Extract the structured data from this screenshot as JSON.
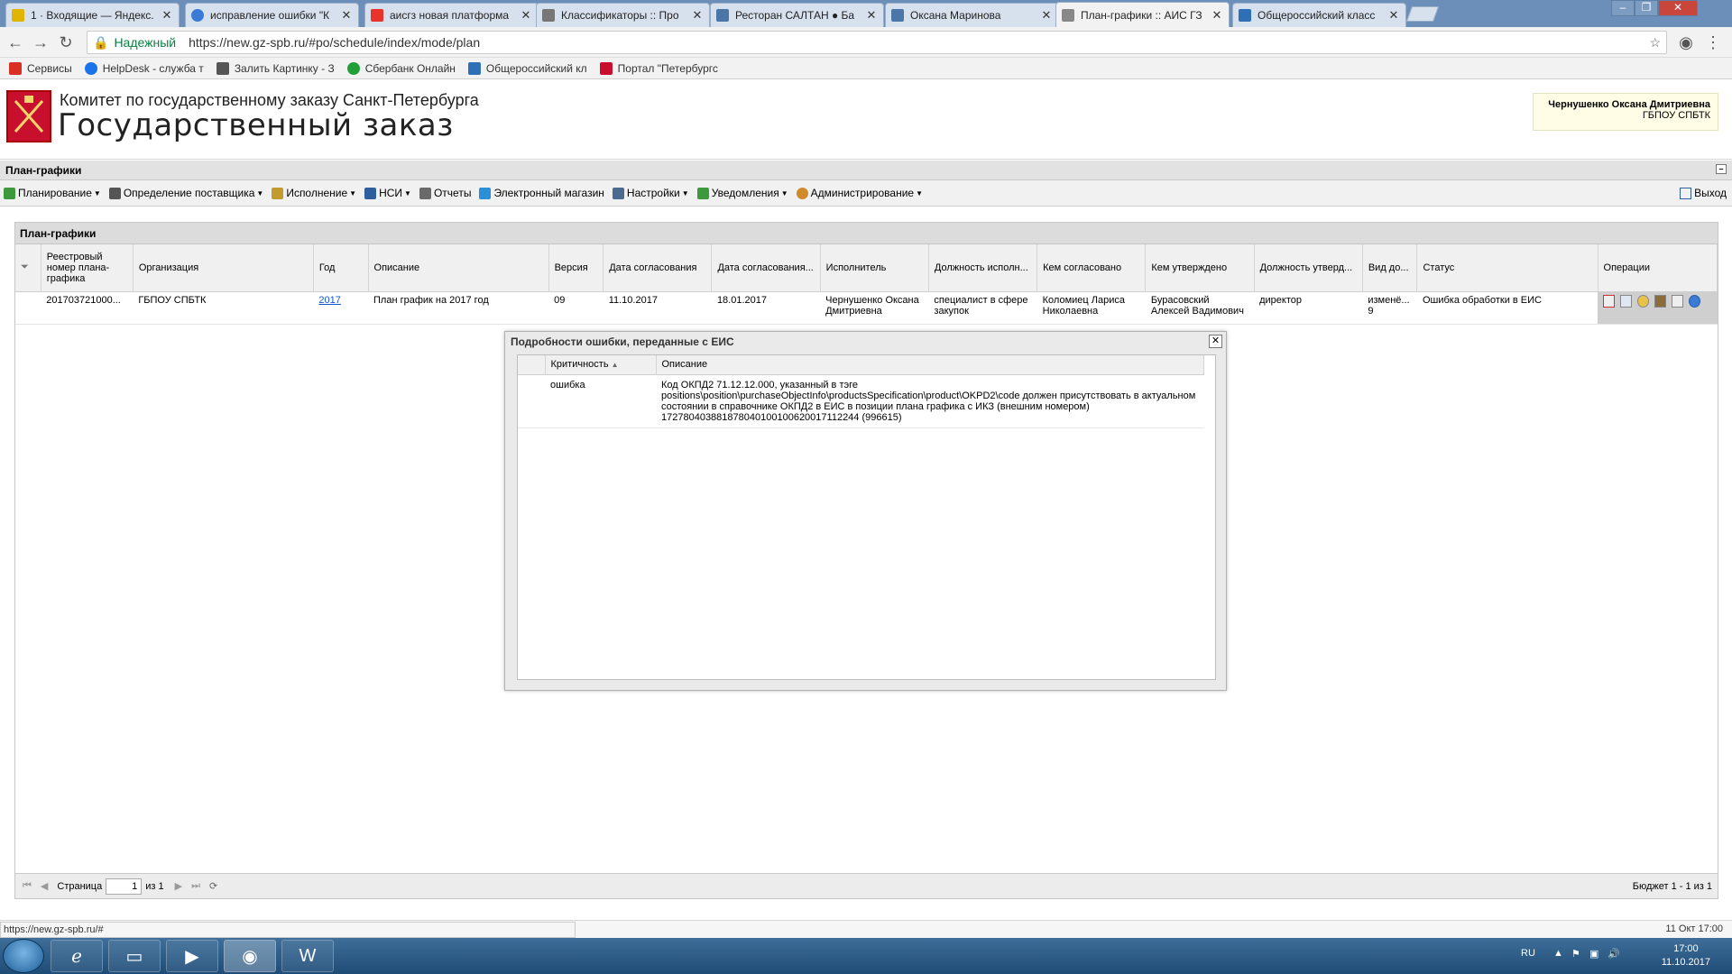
{
  "browser": {
    "tabs": [
      {
        "title": "1 · Входящие — Яндекс.",
        "favicon_color": "#e0b400"
      },
      {
        "title": "исправление ошибки \"К",
        "favicon_color": "#3a7bd5"
      },
      {
        "title": "аисгз новая платформа",
        "favicon_color": "#e8322b"
      },
      {
        "title": "Классификаторы :: Про",
        "favicon_color": "#777777"
      },
      {
        "title": "Ресторан САЛТАН ● Ба",
        "favicon_color": "#4a76a8"
      },
      {
        "title": "Оксана Маринова",
        "favicon_color": "#4a76a8"
      },
      {
        "title": "План-графики :: АИС ГЗ",
        "favicon_color": "#888888"
      },
      {
        "title": "Общероссийский класс",
        "favicon_color": "#2f6fb5"
      }
    ],
    "secure_label": "Надежный",
    "url": "https://new.gz-spb.ru/#po/schedule/index/mode/plan",
    "bookmarks": [
      {
        "label": "Сервисы",
        "color": "#d93025"
      },
      {
        "label": "HelpDesk - служба т",
        "color": "#1a73e8"
      },
      {
        "label": "Залить Картинку - З",
        "color": "#555555"
      },
      {
        "label": "Сбербанк Онлайн",
        "color": "#21a038"
      },
      {
        "label": "Общероссийский кл",
        "color": "#2f6fb5"
      },
      {
        "label": "Портал \"Петербургс",
        "color": "#c8102e"
      }
    ]
  },
  "header": {
    "org_line": "Комитет по государственному заказу Санкт-Петербурга",
    "title": "Государственный заказ",
    "user_name": "Чернушенко Оксана Дмитриевна",
    "user_org": "ГБПОУ СПБТК"
  },
  "section_title": "План-графики",
  "menu": [
    {
      "label": "Планирование",
      "dropdown": true,
      "color": "#3c9a3c"
    },
    {
      "label": "Определение поставщика",
      "dropdown": true,
      "color": "#555555"
    },
    {
      "label": "Исполнение",
      "dropdown": true,
      "color": "#c29a2e"
    },
    {
      "label": "НСИ",
      "dropdown": true,
      "color": "#2f5e9e"
    },
    {
      "label": "Отчеты",
      "dropdown": false,
      "color": "#6a6a6a"
    },
    {
      "label": "Электронный магазин",
      "dropdown": false,
      "color": "#2a8fd6"
    },
    {
      "label": "Настройки",
      "dropdown": true,
      "color": "#4a6b8f"
    },
    {
      "label": "Уведомления",
      "dropdown": true,
      "color": "#3c9a3c"
    },
    {
      "label": "Администрирование",
      "dropdown": true,
      "color": "#d08a2a"
    }
  ],
  "logout_label": "Выход",
  "grid": {
    "title": "План-графики",
    "columns": [
      "",
      "Реестровый номер плана-графика",
      "Организация",
      "Год",
      "Описание",
      "Версия",
      "Дата согласования",
      "Дата согласования...",
      "Исполнитель",
      "Должность исполн...",
      "Кем согласовано",
      "Кем утверждено",
      "Должность утверд...",
      "Вид до...",
      "Статус",
      "Операции"
    ],
    "rows": [
      {
        "reg_number": "201703721000...",
        "organization": "ГБПОУ СПБТК",
        "year": "2017",
        "description": "План график на 2017 год",
        "version": "09",
        "approval_date": "11.10.2017",
        "approval_date2": "18.01.2017",
        "executor": "Чернушенко Оксана Дмитриевна",
        "executor_position": "специалист в сфере закупок",
        "agreed_by": "Коломиец Лариса Николаевна",
        "approved_by": "Бурасовский Алексей Вадимович",
        "approver_position": "директор",
        "doc_type": "изменё... 9",
        "status": "Ошибка обработки в ЕИС"
      }
    ],
    "pager": {
      "page_label": "Страница",
      "page_value": "1",
      "of_label": "из 1",
      "summary": "Бюджет 1 - 1 из 1"
    }
  },
  "dialog": {
    "title": "Подробности ошибки, переданные с ЕИС",
    "columns": [
      "Критичность",
      "Описание"
    ],
    "rows": [
      {
        "severity": "ошибка",
        "description": "Код ОКПД2 71.12.12.000, указанный в тэге positions\\position\\purchaseObjectInfo\\productsSpecification\\product\\OKPD2\\code должен присутствовать в актуальном состоянии в справочнике ОКПД2 в ЕИС в позиции плана графика с ИКЗ (внешним номером) 172780403881878040100100620017112244 (996615)"
      }
    ]
  },
  "statusbar": {
    "url": "https://new.gz-spb.ru/#",
    "datetime": "11 Окт 17:00"
  },
  "taskbar": {
    "lang": "RU",
    "time": "17:00",
    "date": "11.10.2017"
  }
}
